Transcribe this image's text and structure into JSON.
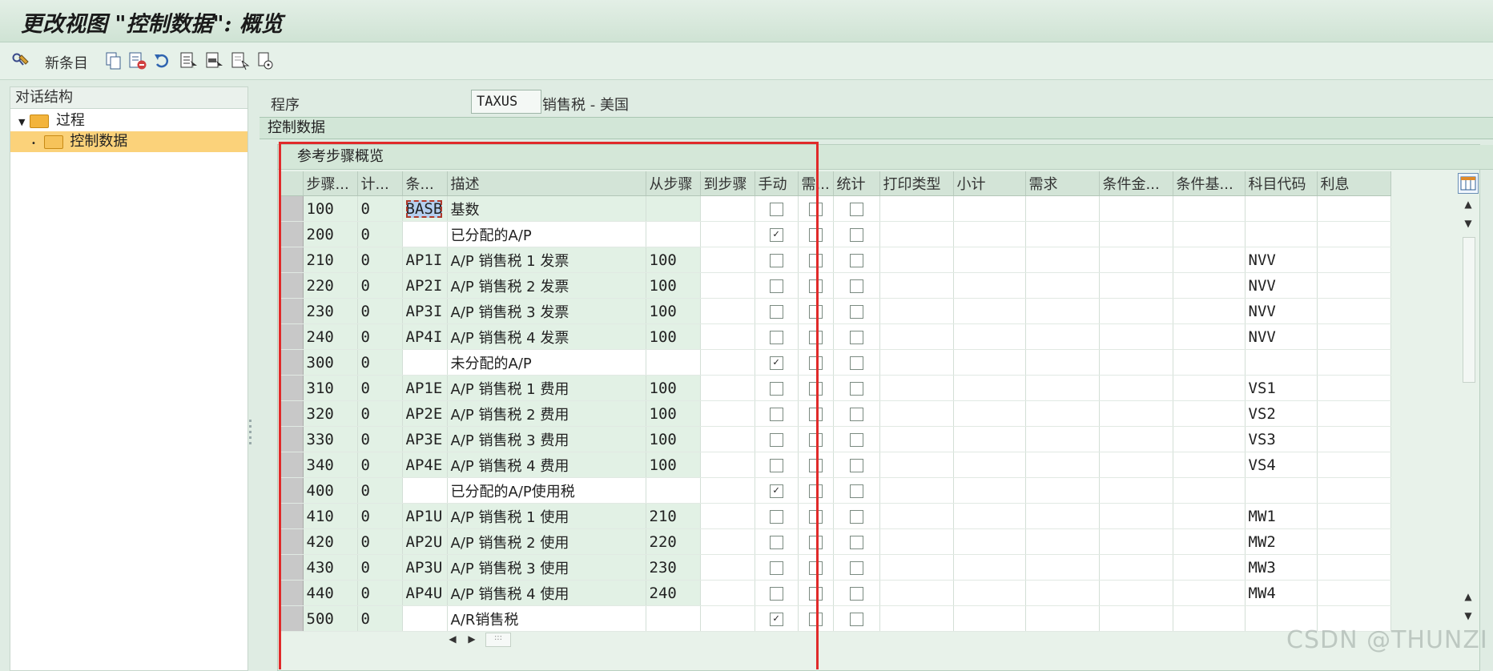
{
  "window": {
    "title": "更改视图 \"控制数据\": 概览"
  },
  "toolbar": {
    "new_entries_label": "新条目",
    "icons": [
      "display-change-icon",
      "copy-icon",
      "delete-icon",
      "undo-icon",
      "select-all-icon",
      "select-block-icon",
      "deselect-all-icon",
      "print-icon"
    ]
  },
  "dialog_structure": {
    "header": "对话结构",
    "items": [
      {
        "label": "过程",
        "level": 0,
        "selected": false
      },
      {
        "label": "控制数据",
        "level": 1,
        "selected": true
      }
    ]
  },
  "procedure": {
    "label": "程序",
    "value": "TAXUS",
    "description": "销售税 - 美国"
  },
  "section_title": "控制数据",
  "table_control": {
    "title": "参考步骤概览",
    "columns": [
      "步骤...",
      "计...",
      "条...",
      "描述",
      "从步骤",
      "到步骤",
      "手动",
      "需...",
      "统计",
      "打印类型",
      "小计",
      "需求",
      "条件金...",
      "条件基...",
      "科目代码",
      "利息"
    ],
    "rows": [
      {
        "step": "100",
        "counter": "0",
        "ctype": "BASB",
        "desc": "基数",
        "from": "",
        "manual": false,
        "acct": "",
        "focused": true
      },
      {
        "step": "200",
        "counter": "0",
        "ctype": "",
        "desc": "已分配的A/P",
        "from": "",
        "manual": true,
        "acct": ""
      },
      {
        "step": "210",
        "counter": "0",
        "ctype": "AP1I",
        "desc": "A/P 销售税 1 发票",
        "from": "100",
        "manual": false,
        "acct": "NVV"
      },
      {
        "step": "220",
        "counter": "0",
        "ctype": "AP2I",
        "desc": "A/P 销售税 2 发票",
        "from": "100",
        "manual": false,
        "acct": "NVV"
      },
      {
        "step": "230",
        "counter": "0",
        "ctype": "AP3I",
        "desc": "A/P 销售税 3 发票",
        "from": "100",
        "manual": false,
        "acct": "NVV"
      },
      {
        "step": "240",
        "counter": "0",
        "ctype": "AP4I",
        "desc": "A/P 销售税 4 发票",
        "from": "100",
        "manual": false,
        "acct": "NVV"
      },
      {
        "step": "300",
        "counter": "0",
        "ctype": "",
        "desc": "未分配的A/P",
        "from": "",
        "manual": true,
        "acct": ""
      },
      {
        "step": "310",
        "counter": "0",
        "ctype": "AP1E",
        "desc": "A/P 销售税 1 费用",
        "from": "100",
        "manual": false,
        "acct": "VS1"
      },
      {
        "step": "320",
        "counter": "0",
        "ctype": "AP2E",
        "desc": "A/P 销售税 2 费用",
        "from": "100",
        "manual": false,
        "acct": "VS2"
      },
      {
        "step": "330",
        "counter": "0",
        "ctype": "AP3E",
        "desc": "A/P 销售税 3 费用",
        "from": "100",
        "manual": false,
        "acct": "VS3"
      },
      {
        "step": "340",
        "counter": "0",
        "ctype": "AP4E",
        "desc": "A/P 销售税 4 费用",
        "from": "100",
        "manual": false,
        "acct": "VS4"
      },
      {
        "step": "400",
        "counter": "0",
        "ctype": "",
        "desc": "已分配的A/P使用税",
        "from": "",
        "manual": true,
        "acct": ""
      },
      {
        "step": "410",
        "counter": "0",
        "ctype": "AP1U",
        "desc": "A/P 销售税 1 使用",
        "from": "210",
        "manual": false,
        "acct": "MW1"
      },
      {
        "step": "420",
        "counter": "0",
        "ctype": "AP2U",
        "desc": "A/P 销售税 2 使用",
        "from": "220",
        "manual": false,
        "acct": "MW2"
      },
      {
        "step": "430",
        "counter": "0",
        "ctype": "AP3U",
        "desc": "A/P 销售税 3 使用",
        "from": "230",
        "manual": false,
        "acct": "MW3"
      },
      {
        "step": "440",
        "counter": "0",
        "ctype": "AP4U",
        "desc": "A/P 销售税 4 使用",
        "from": "240",
        "manual": false,
        "acct": "MW4"
      },
      {
        "step": "500",
        "counter": "0",
        "ctype": "",
        "desc": "A/R销售税",
        "from": "",
        "manual": true,
        "acct": ""
      }
    ]
  },
  "watermark": "CSDN @THUNZI"
}
